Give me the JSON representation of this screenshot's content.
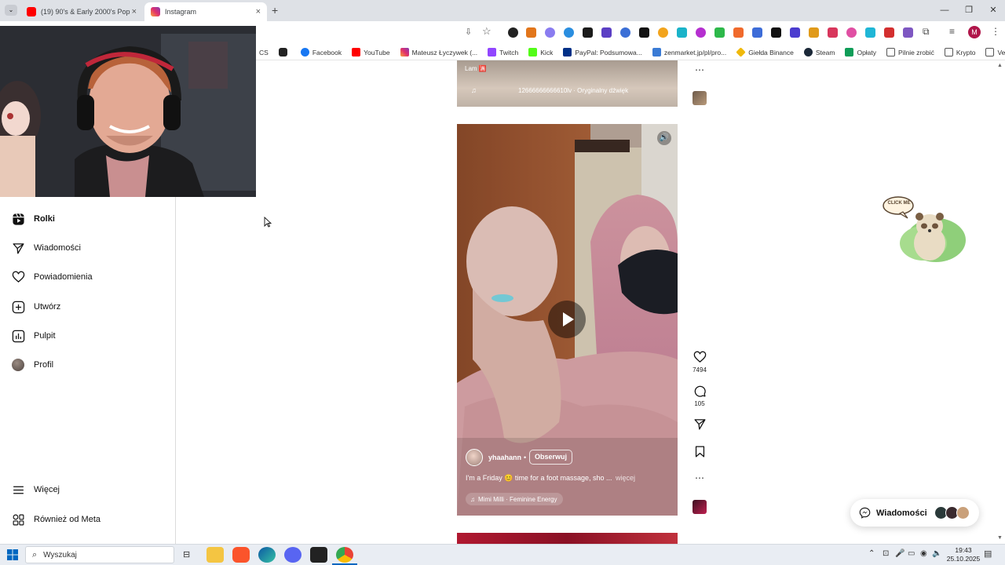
{
  "browser": {
    "tabs": [
      {
        "title": "(19) 90's & Early 2000's Pop Pa",
        "close": "×"
      },
      {
        "title": "Instagram",
        "close": "×"
      }
    ],
    "new_tab": "+",
    "profile_initial": "M",
    "bookmarks": [
      {
        "label": "CS",
        "icon": "none"
      },
      {
        "label": "",
        "icon": "g-icon"
      },
      {
        "label": "Facebook",
        "icon": "facebook-icon"
      },
      {
        "label": "YouTube",
        "icon": "youtube-icon"
      },
      {
        "label": "Mateusz Łyczywek (...",
        "icon": "instagram-icon"
      },
      {
        "label": "Twitch",
        "icon": "twitch-icon"
      },
      {
        "label": "Kick",
        "icon": "kick-icon"
      },
      {
        "label": "PayPal: Podsumowa...",
        "icon": "paypal-icon"
      },
      {
        "label": "zenmarket.jp/pl/pro...",
        "icon": "zenmarket-icon"
      },
      {
        "label": "Giełda Binance",
        "icon": "binance-icon"
      },
      {
        "label": "Steam",
        "icon": "steam-icon"
      },
      {
        "label": "Opłaty",
        "icon": "sheets-icon"
      },
      {
        "label": "Pilnie zrobić",
        "icon": "folder-icon"
      },
      {
        "label": "Krypto",
        "icon": "folder-icon"
      },
      {
        "label": "Vesting",
        "icon": "folder-icon"
      }
    ],
    "more_bookmarks": "»"
  },
  "sidebar": {
    "items": [
      {
        "label": "Rolki",
        "icon": "reels-icon"
      },
      {
        "label": "Wiadomości",
        "icon": "paper-plane-icon"
      },
      {
        "label": "Powiadomienia",
        "icon": "heart-icon"
      },
      {
        "label": "Utwórz",
        "icon": "plus-square-icon"
      },
      {
        "label": "Pulpit",
        "icon": "bar-chart-icon"
      },
      {
        "label": "Profil",
        "icon": "avatar"
      }
    ],
    "bottom": [
      {
        "label": "Więcej",
        "icon": "menu-icon"
      },
      {
        "label": "Również od Meta",
        "icon": "meta-apps-icon"
      }
    ]
  },
  "reel_prev": {
    "caption": "Lam 🈵",
    "audio": "12666666666610lv · Oryginalny dźwięk"
  },
  "reel_main": {
    "username": "yhaahann",
    "separator": "•",
    "follow": "Obserwuj",
    "caption": "I'm a Friday 😊 time for a foot massage, sho ...",
    "more": "więcej",
    "audio": "Mimi Milli · Feminine Energy",
    "likes": "7494",
    "comments": "105"
  },
  "sticker_text": "CLICK ME",
  "messages": {
    "label": "Wiadomości"
  },
  "taskbar": {
    "search_placeholder": "Wyszukaj",
    "time": "19:43",
    "date": "25.10.2025"
  },
  "colors": {
    "ig_red": "#ff3040",
    "chrome_tab_bg": "#dee1e6",
    "taskbar_bg": "#e9edf3"
  }
}
